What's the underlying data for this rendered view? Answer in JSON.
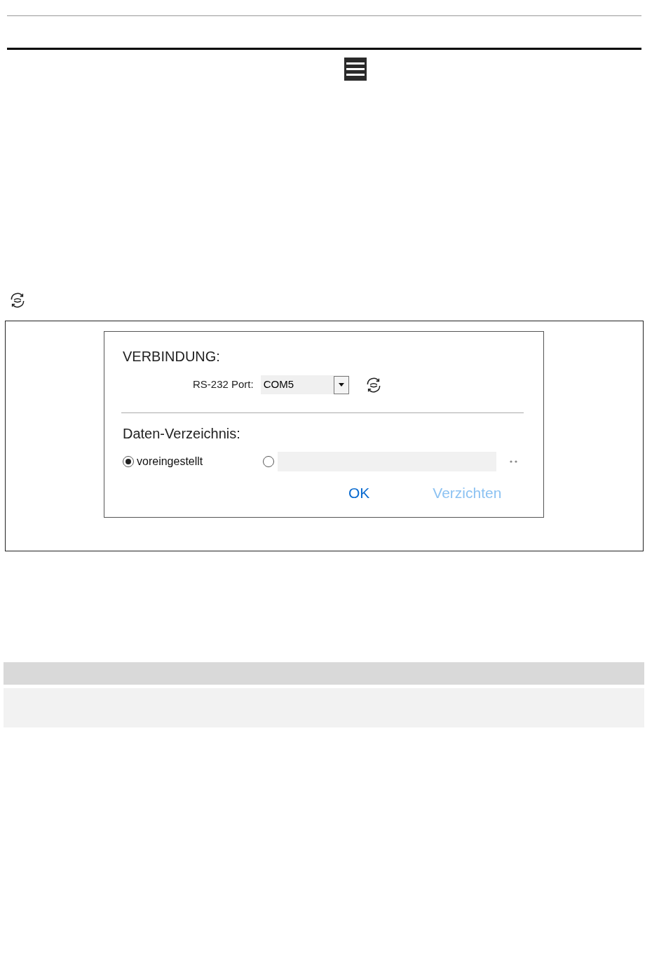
{
  "dialog": {
    "connection": {
      "title": "VERBINDUNG:",
      "port_label": "RS-232 Port:",
      "port_value": "COM5"
    },
    "directory": {
      "title": "Daten-Verzeichnis:",
      "options": [
        {
          "kind": "preset",
          "label": "voreingestellt",
          "selected": true
        },
        {
          "kind": "path",
          "selected": false
        }
      ]
    },
    "buttons": [
      {
        "label": "OK",
        "disabled": false
      },
      {
        "label": "Verzichten",
        "disabled": true
      }
    ]
  }
}
